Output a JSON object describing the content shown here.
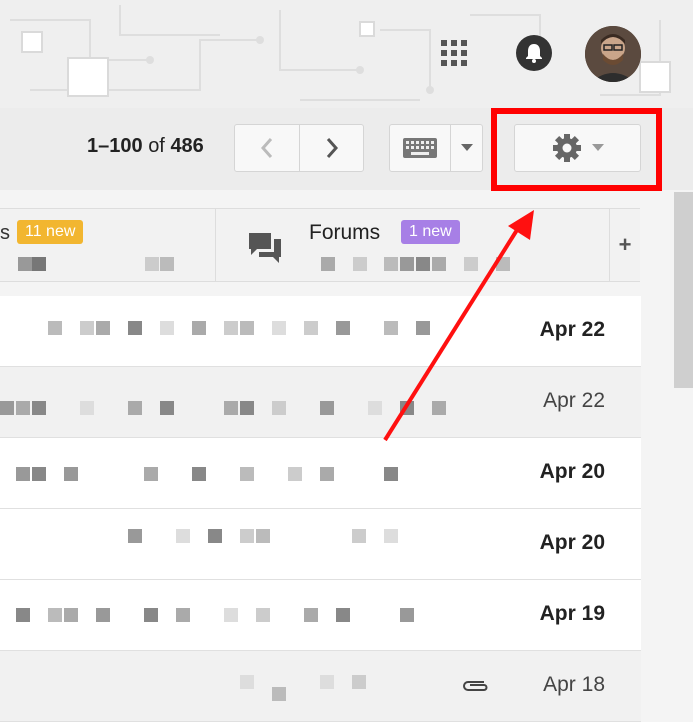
{
  "pager": {
    "range": "1–100",
    "of": "of",
    "total": "486"
  },
  "tabs": {
    "social": {
      "label_fragment": "s",
      "badge": "11 new"
    },
    "forums": {
      "label": "Forums",
      "badge": "1 new"
    },
    "add": "+"
  },
  "messages": [
    {
      "date": "Apr 22",
      "unread": true
    },
    {
      "date": "Apr 22",
      "unread": false
    },
    {
      "date": "Apr 20",
      "unread": true
    },
    {
      "date": "Apr 20",
      "unread": true
    },
    {
      "date": "Apr 19",
      "unread": true
    },
    {
      "date": "Apr 18",
      "unread": false,
      "attachment": true
    }
  ],
  "icons": {
    "apps": "apps-grid-icon",
    "notifications": "bell-icon",
    "prev": "chevron-left-icon",
    "next": "chevron-right-icon",
    "keyboard": "keyboard-icon",
    "settings": "gear-icon",
    "forums": "chat-bubbles-icon",
    "attachment": "paperclip-icon"
  },
  "colors": {
    "highlight": "#ff0000",
    "social_badge": "#f2b630",
    "forums_badge": "#a77fe6"
  }
}
